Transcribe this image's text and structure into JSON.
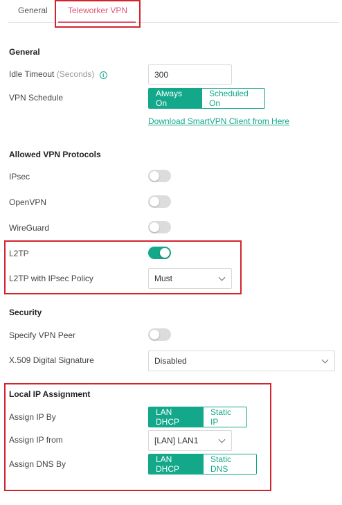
{
  "tabs": [
    {
      "label": "General"
    },
    {
      "label": "Teleworker VPN"
    }
  ],
  "colors": {
    "accent": "#14a88a",
    "active_tab": "#e0566f",
    "highlight_box": "#d3242c"
  },
  "general": {
    "title": "General",
    "idle_timeout_label": "Idle Timeout",
    "idle_timeout_unit": "(Seconds)",
    "idle_timeout_info_icon": "info-icon",
    "idle_timeout_value": "300",
    "vpn_schedule_label": "VPN Schedule",
    "vpn_schedule_options": [
      "Always On",
      "Scheduled On"
    ],
    "vpn_schedule_selected": "Always On",
    "download_link": "Download SmartVPN Client from Here"
  },
  "protocols": {
    "title": "Allowed VPN Protocols",
    "ipsec": {
      "label": "IPsec",
      "enabled": false
    },
    "openvpn": {
      "label": "OpenVPN",
      "enabled": false
    },
    "wireguard": {
      "label": "WireGuard",
      "enabled": false
    },
    "l2tp": {
      "label": "L2TP",
      "enabled": true
    },
    "l2tp_policy_label": "L2TP with IPsec Policy",
    "l2tp_policy_value": "Must"
  },
  "security": {
    "title": "Security",
    "specify_peer": {
      "label": "Specify VPN Peer",
      "enabled": false
    },
    "x509_label": "X.509 Digital Signature",
    "x509_value": "Disabled"
  },
  "local_ip": {
    "title": "Local IP Assignment",
    "assign_ip_by_label": "Assign IP By",
    "assign_ip_by_options": [
      "LAN DHCP",
      "Static IP"
    ],
    "assign_ip_by_selected": "LAN DHCP",
    "assign_ip_from_label": "Assign IP from",
    "assign_ip_from_value": "[LAN] LAN1",
    "assign_dns_by_label": "Assign DNS By",
    "assign_dns_by_options": [
      "LAN DHCP",
      "Static DNS"
    ],
    "assign_dns_by_selected": "LAN DHCP"
  }
}
